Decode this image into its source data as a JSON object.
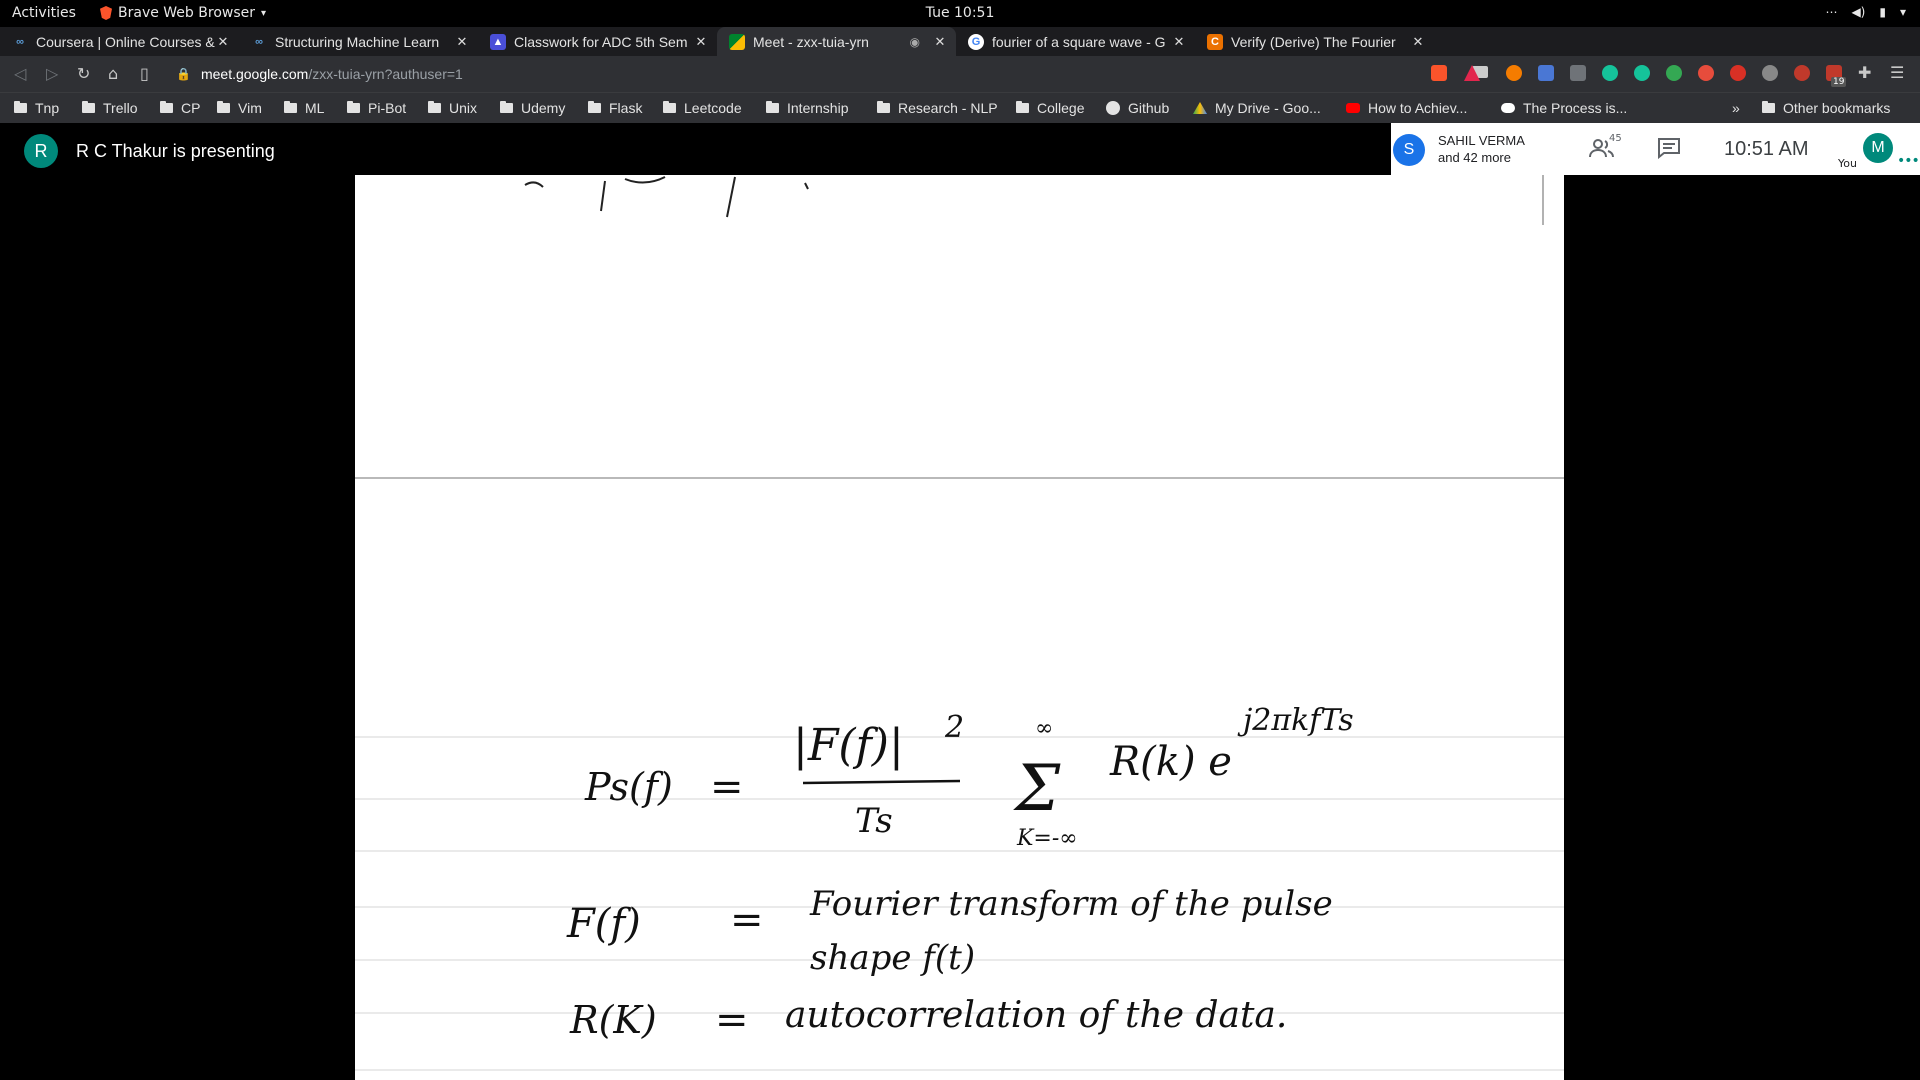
{
  "system": {
    "activities": "Activities",
    "app_name": "Brave Web Browser",
    "clock": "Tue 10:51"
  },
  "tabs": [
    {
      "title": "Coursera | Online Courses &",
      "favicon": "infinity-icon",
      "color": "#5b9bd5"
    },
    {
      "title": "Structuring Machine Learn",
      "favicon": "infinity-icon",
      "color": "#5b9bd5"
    },
    {
      "title": "Classwork for ADC 5th Sem",
      "favicon": "classroom-icon",
      "color": "#4a4fd8"
    },
    {
      "title": "Meet - zxx-tuia-yrn",
      "favicon": "meet-icon",
      "color": "#00832d",
      "active": true
    },
    {
      "title": "fourier of a square wave - G",
      "favicon": "google-icon",
      "color": "#ffffff"
    },
    {
      "title": "Verify (Derive) The Fourier",
      "favicon": "chegg-icon",
      "color": "#eb7100"
    }
  ],
  "address": {
    "domain": "meet.google.com",
    "path": "/zxx-tuia-yrn?authuser=1"
  },
  "bookmarks": [
    "Tnp",
    "Trello",
    "CP",
    "Vim",
    "ML",
    "Pi-Bot",
    "Unix",
    "Udemy",
    "Flask",
    "Leetcode",
    "Internship",
    "Research - NLP",
    "College",
    "Github",
    "My Drive - Goo...",
    "How to Achiev...",
    "The Process is..."
  ],
  "bookmarks_overflow": "»",
  "other_bookmarks": "Other bookmarks",
  "extension_badge": "19",
  "meet": {
    "presenter_initial": "R",
    "presenter_text": "R C Thakur is presenting",
    "participant_initial": "S",
    "participant_name": "SAHIL VERMA",
    "participant_more": "and 42 more",
    "participant_count": "45",
    "time": "10:51  AM",
    "self_initial": "M",
    "self_label": "You"
  },
  "slide": {
    "eq1_lhs": "Ps(f)",
    "eq1_eq": "=",
    "eq1_num": "|F(f)|",
    "eq1_sq": "2",
    "eq1_den": "Ts",
    "eq1_sum_top": "∞",
    "eq1_sum_bot": "K=-∞",
    "eq1_term": "R(k) e",
    "eq1_exp": "j2πkfTs",
    "line2_lhs": "F(f)",
    "line2_eq": "=",
    "line2_rhs1": "Fourier transform of the pulse",
    "line2_rhs2": "shape f(t)",
    "line3_lhs": "R(K)",
    "line3_eq": "=",
    "line3_rhs": "autocorrelation of the data."
  }
}
